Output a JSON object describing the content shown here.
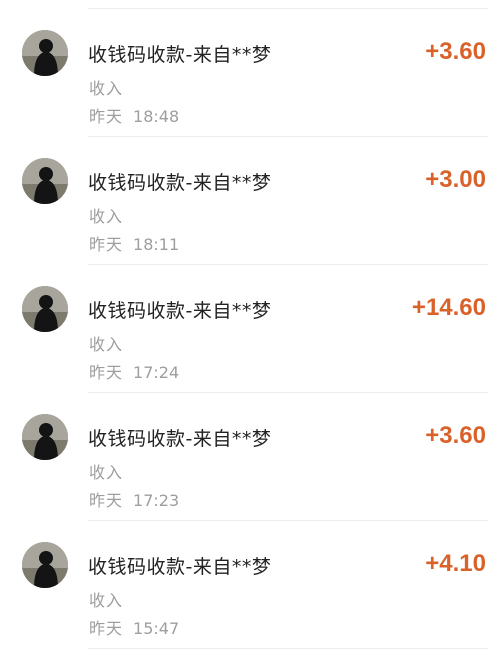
{
  "colors": {
    "amount": "#d9622b",
    "title": "#222222",
    "meta": "#9e9e9e"
  },
  "transactions": [
    {
      "avatar_icon": "user-avatar-icon",
      "title": "收钱码收款-来自**梦",
      "type": "收入",
      "day": "昨天",
      "time": "18:48",
      "amount": "+3.60"
    },
    {
      "avatar_icon": "user-avatar-icon",
      "title": "收钱码收款-来自**梦",
      "type": "收入",
      "day": "昨天",
      "time": "18:11",
      "amount": "+3.00"
    },
    {
      "avatar_icon": "user-avatar-icon",
      "title": "收钱码收款-来自**梦",
      "type": "收入",
      "day": "昨天",
      "time": "17:24",
      "amount": "+14.60"
    },
    {
      "avatar_icon": "user-avatar-icon",
      "title": "收钱码收款-来自**梦",
      "type": "收入",
      "day": "昨天",
      "time": "17:23",
      "amount": "+3.60"
    },
    {
      "avatar_icon": "user-avatar-icon",
      "title": "收钱码收款-来自**梦",
      "type": "收入",
      "day": "昨天",
      "time": "15:47",
      "amount": "+4.10"
    }
  ]
}
